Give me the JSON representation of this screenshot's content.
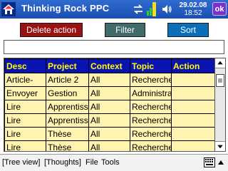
{
  "titlebar": {
    "app_title": "Thinking Rock PPC",
    "date": "29.02.08",
    "time": "18:52",
    "ok_label": "ok"
  },
  "toolbar": {
    "delete_label": "Delete action",
    "filter_label": "Filter",
    "sort_label": "Sort"
  },
  "search": {
    "value": ""
  },
  "table": {
    "columns": [
      "Desc",
      "Project",
      "Context",
      "Topic",
      "Action"
    ],
    "rows": [
      [
        "Article-",
        "Article 2",
        "All",
        "Recherche",
        ""
      ],
      [
        "Envoyer",
        "Gestion",
        "All",
        "Administra",
        ""
      ],
      [
        "Lire",
        "Apprentiss",
        "All",
        "Recherche",
        ""
      ],
      [
        "Lire",
        "Apprentiss",
        "All",
        "Recherche",
        ""
      ],
      [
        "Lire",
        "Thèse",
        "All",
        "Recherche",
        ""
      ],
      [
        "Lire",
        "Thèse",
        "All",
        "Recherche",
        ""
      ]
    ]
  },
  "menu": {
    "tree_view": "[Tree view]",
    "thoughts": "[Thoughts]",
    "file": "File",
    "tools": "Tools"
  },
  "icons": {
    "app": "home-icon",
    "sync": "sync-icon",
    "signal": "signal-icon",
    "volume": "volume-icon",
    "keyboard": "keyboard-icon"
  },
  "colors": {
    "titlebar": "#1b4fb0",
    "delete_button": "#9b1212",
    "filter_button": "#3f6b6b",
    "sort_button": "#0a6fbb",
    "table_header_bg": "#0a12b0",
    "table_header_text": "#ffff00",
    "table_cell_bg": "#fff3b0",
    "ok_button": "#7b2fd0"
  }
}
